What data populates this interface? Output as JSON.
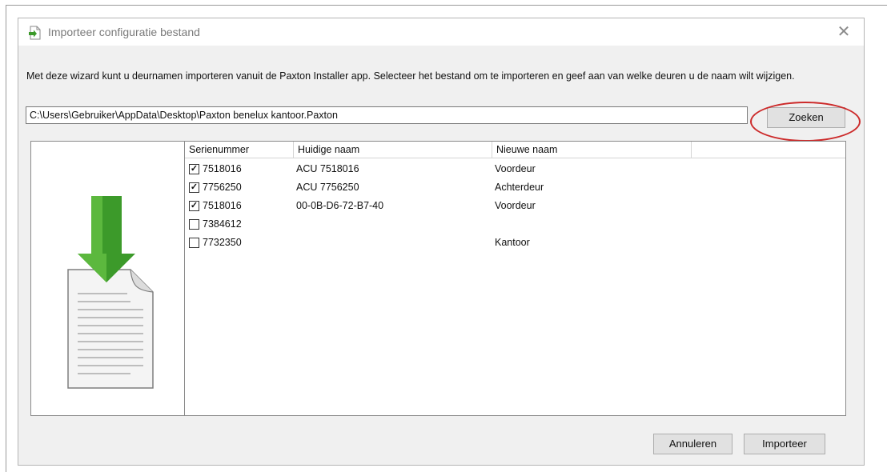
{
  "window": {
    "title": "Importeer configuratie bestand",
    "close_glyph": "✕",
    "title_icon": "import-file-icon"
  },
  "intro_text": "Met deze wizard kunt u deurnamen importeren vanuit de Paxton Installer app. Selecteer het bestand om te importeren en geef aan van welke deuren u de naam wilt wijzigen.",
  "file_path": "C:\\Users\\Gebruiker\\AppData\\Desktop\\Paxton benelux kantoor.Paxton",
  "search_button": "Zoeken",
  "illustration_icon": "download-document-icon",
  "table": {
    "columns": [
      "Serienummer",
      "Huidige naam",
      "Nieuwe naam",
      ""
    ],
    "rows": [
      {
        "checked": true,
        "serial": "7518016",
        "current": "ACU 7518016",
        "new": "Voordeur"
      },
      {
        "checked": true,
        "serial": "7756250",
        "current": "ACU 7756250",
        "new": "Achterdeur"
      },
      {
        "checked": true,
        "serial": "7518016",
        "current": "00-0B-D6-72-B7-40",
        "new": "Voordeur"
      },
      {
        "checked": false,
        "serial": "7384612",
        "current": "",
        "new": ""
      },
      {
        "checked": false,
        "serial": "7732350",
        "current": "",
        "new": "Kantoor"
      }
    ]
  },
  "buttons": {
    "cancel": "Annuleren",
    "import": "Importeer"
  },
  "colors": {
    "annotation": "#cc2a2a",
    "arrow_green": "#3c9a2a",
    "dialog_bg": "#f0f0f0"
  }
}
